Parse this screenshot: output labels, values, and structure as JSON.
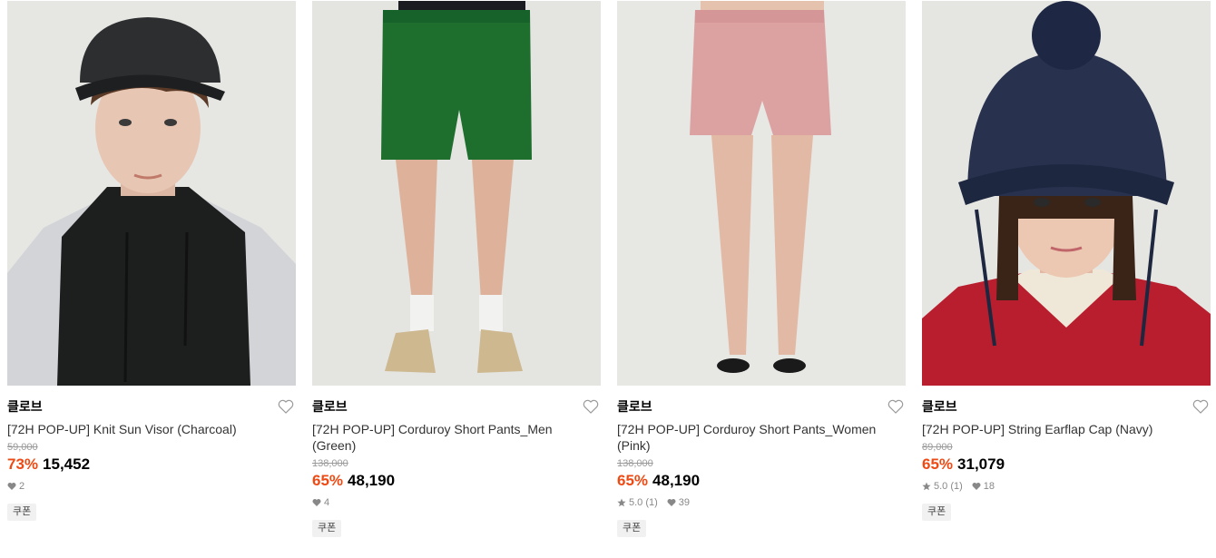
{
  "products": [
    {
      "brand": "클로브",
      "name": "[72H POP-UP] Knit Sun Visor (Charcoal)",
      "original_price": "59,000",
      "discount": "73%",
      "price": "15,452",
      "rating": null,
      "likes": "2",
      "coupon": "쿠폰",
      "image": "model-knit-sun-visor-charcoal"
    },
    {
      "brand": "클로브",
      "name": "[72H POP-UP] Corduroy Short Pants_Men (Green)",
      "original_price": "138,000",
      "discount": "65%",
      "price": "48,190",
      "rating": null,
      "likes": "4",
      "coupon": "쿠폰",
      "image": "model-corduroy-shorts-green"
    },
    {
      "brand": "클로브",
      "name": "[72H POP-UP] Corduroy Short Pants_Women (Pink)",
      "original_price": "138,000",
      "discount": "65%",
      "price": "48,190",
      "rating": "5.0 (1)",
      "likes": "39",
      "coupon": "쿠폰",
      "image": "model-corduroy-shorts-pink"
    },
    {
      "brand": "클로브",
      "name": "[72H POP-UP] String Earflap Cap (Navy)",
      "original_price": "89,000",
      "discount": "65%",
      "price": "31,079",
      "rating": "5.0 (1)",
      "likes": "18",
      "coupon": "쿠폰",
      "image": "model-string-earflap-cap-navy"
    }
  ],
  "colors": {
    "discount": "#ee4a14",
    "meta": "#888888",
    "coupon_bg": "#f1f1f1"
  },
  "icons": {
    "wishlist": "heart-outline-icon",
    "likes": "heart-filled-icon",
    "rating": "star-icon"
  }
}
